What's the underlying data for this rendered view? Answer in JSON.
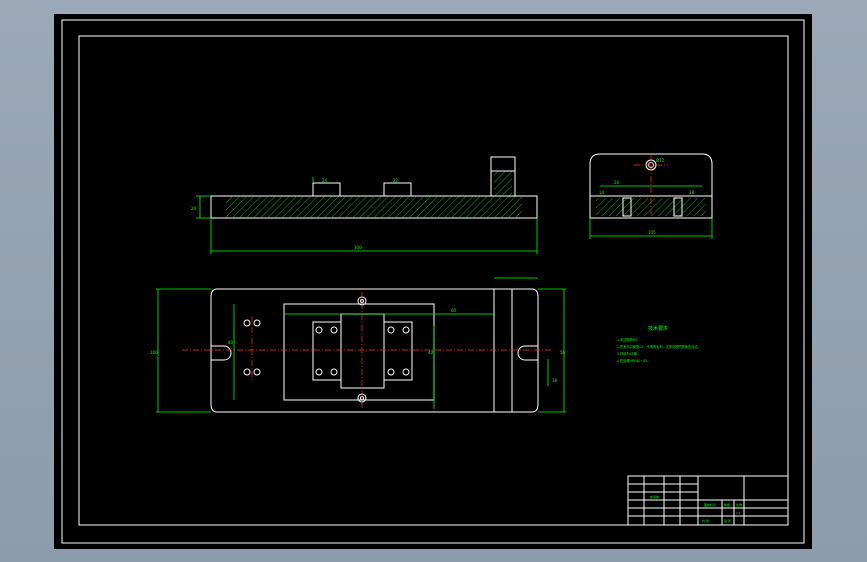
{
  "drawing": {
    "colors": {
      "background": "#000000",
      "outline": "#ffffff",
      "dimension": "#00ff00",
      "centerline": "#ff3030",
      "hatch": "#00ff00",
      "viewport_frame": "#8d9cac"
    },
    "front_view": {
      "dim_height": "20",
      "dim_length": "300",
      "dim_boss1": "24",
      "dim_boss2": "22"
    },
    "side_view": {
      "dim_width": "105",
      "dim_hole": "Ø12",
      "dim_inner": "20",
      "dim_slot1": "14",
      "dim_slot2": "18"
    },
    "plan_view": {
      "dim_total_height": "100",
      "dim_inner_width": "80",
      "dim_pitch": "60",
      "dim_right": "56",
      "dim_mid": "40",
      "dim_small": "18"
    },
    "notes": {
      "title": "技术要求",
      "lines": [
        "1.未注圆角R2。",
        "2.所有孔口倒角C1，不得有毛刺，正常处理的表面应清洁。",
        "3.材料为45钢。",
        "4.热处理HRC40~45。"
      ]
    },
    "title_block": {
      "cells": [
        "夹具体",
        "比例",
        "1:1",
        "图样标记",
        "重量",
        "共 张",
        "第 张"
      ]
    }
  }
}
